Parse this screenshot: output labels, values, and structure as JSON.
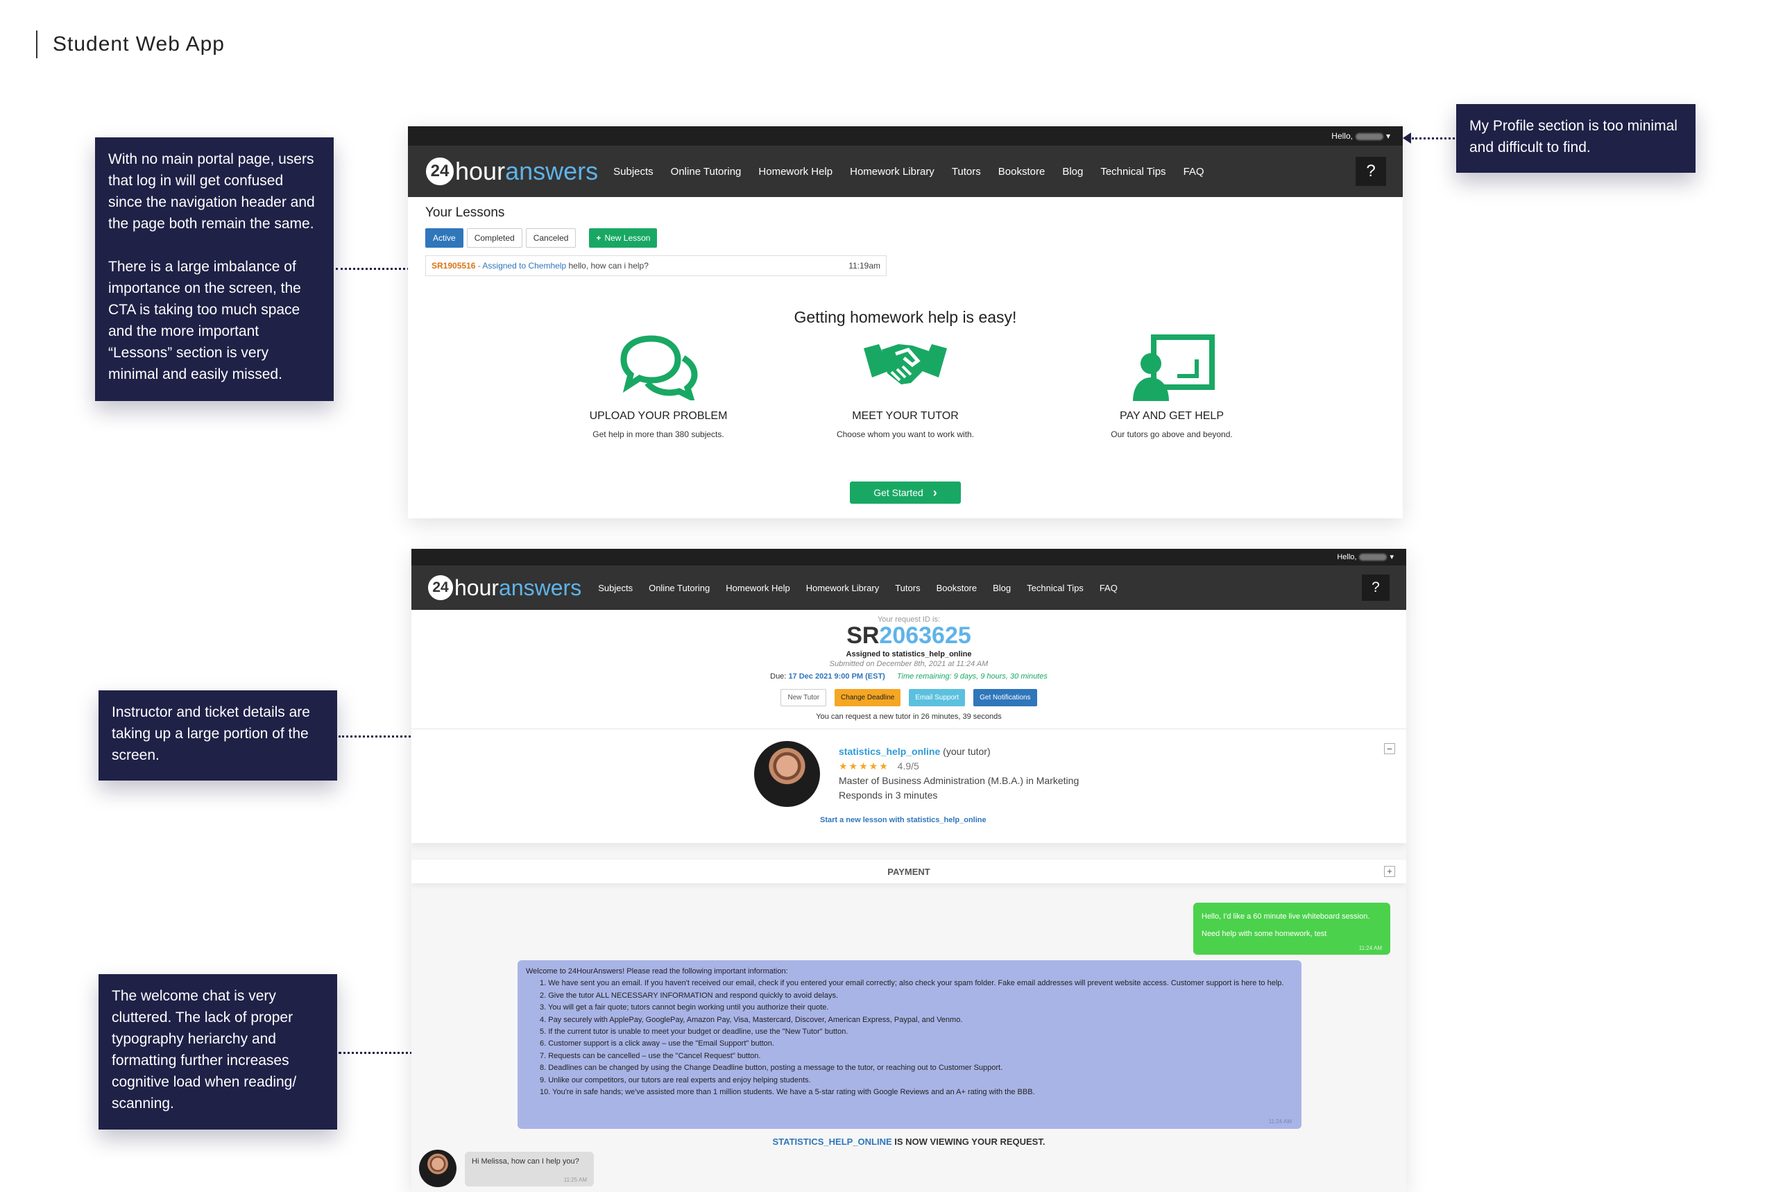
{
  "page": {
    "title": "Student Web App"
  },
  "notes": {
    "left1": "With no main portal page, users that log in will get confused since the navigation header and the page both remain the same.\n\nThere is a large imbalance of importance on the screen, the CTA is taking too much space and the more important “Lessons” section is very minimal and easily missed.",
    "right1": "My Profile section is too minimal and difficult to find.",
    "left2": "Instructor and ticket details are taking up a large portion of the screen.",
    "left3": "The welcome chat is very cluttered. The lack of proper typography heriarchy and formatting further increases cognitive load when reading/ scanning."
  },
  "app": {
    "hello": "Hello,",
    "logo_num": "24",
    "logo_hour": "hour",
    "logo_answers": "answers",
    "nav": [
      "Subjects",
      "Online Tutoring",
      "Homework Help",
      "Homework Library",
      "Tutors",
      "Bookstore",
      "Blog",
      "Technical Tips",
      "FAQ"
    ],
    "help": "?"
  },
  "lessons": {
    "title": "Your Lessons",
    "tabs": [
      "Active",
      "Completed",
      "Canceled"
    ],
    "new_lesson": "New Lesson",
    "item": {
      "id": "SR1905516",
      "sep": " - ",
      "assigned": "Assigned to Chemhelp",
      "msg": " hello, how can i help?",
      "time": "11:19am"
    }
  },
  "steps": {
    "heading": "Getting homework help is easy!",
    "items": [
      {
        "title": "UPLOAD YOUR PROBLEM",
        "sub": "Get help in more than 380 subjects."
      },
      {
        "title": "MEET YOUR TUTOR",
        "sub": "Choose whom you want to work with."
      },
      {
        "title": "PAY AND GET HELP",
        "sub": "Our tutors go above and beyond."
      }
    ],
    "cta": "Get Started"
  },
  "request": {
    "label": "Your request ID is:",
    "sr_prefix": "SR",
    "sr_num": "2063625",
    "assigned": "Assigned to statistics_help_online",
    "submitted": "Submitted on December 8th, 2021 at 11:24 AM",
    "due_label": "Due:",
    "due_value": "17 Dec 2021 9:00 PM (EST)",
    "time_remaining": "Time remaining: 9 days, 9 hours, 30 minutes",
    "buttons": [
      "New Tutor",
      "Change Deadline",
      "Email Support",
      "Get Notifications"
    ],
    "new_tutor_note": "You can request a new tutor in 26 minutes, 39 seconds"
  },
  "tutor": {
    "name": "statistics_help_online",
    "role": " (your tutor)",
    "stars": "★★★★★",
    "rating": "4.9/5",
    "degree": "Master of Business Administration (M.B.A.) in Marketing",
    "responds": "Responds in 3 minutes",
    "start_link": "Start a new lesson with statistics_help_online",
    "collapse": "−"
  },
  "payment": {
    "label": "PAYMENT",
    "expand": "+"
  },
  "chat": {
    "user_msg1": "Hello, I'd like a 60 minute live whiteboard session.",
    "user_msg2": "Need help with some homework, test",
    "user_time": "11:24 AM",
    "welcome_intro": "Welcome to 24HourAnswers! Please read the following important information:",
    "welcome_items": [
      "1. We have sent you an email. If you haven't received our email, check if you entered your email correctly; also check your spam folder. Fake email addresses will prevent website access. Customer support is here to help.",
      "2. Give the tutor ALL NECESSARY INFORMATION and respond quickly to avoid delays.",
      "3. You will get a fair quote; tutors cannot begin working until you authorize their quote.",
      "4. Pay securely with ApplePay, GooglePay, Amazon Pay, Visa, Mastercard, Discover, American Express, Paypal, and Venmo.",
      "5. If the current tutor is unable to meet your budget or deadline, use the \"New Tutor\" button.",
      "6. Customer support is a click away – use the \"Email Support\" button.",
      "7. Requests can be cancelled – use the \"Cancel Request\" button.",
      "8. Deadlines can be changed by using the Change Deadline button, posting a message to the tutor, or reaching out to Customer Support.",
      "9. Unlike our competitors, our tutors are real experts and enjoy helping students.",
      "10. You're in safe hands; we've assisted more than 1 million students. We have a 5-star rating with Google Reviews and an A+ rating with the BBB."
    ],
    "welcome_time": "11:24 AM",
    "viewing_name": "STATISTICS_HELP_ONLINE",
    "viewing_rest": " IS NOW VIEWING YOUR REQUEST.",
    "tutor_msg": "Hi Melissa, how can I help you?",
    "tutor_time": "11:25 AM"
  },
  "colors": {
    "accent_blue": "#2f76bb",
    "green": "#19a864",
    "navy": "#1f2147",
    "orange": "#f5a623",
    "cyan": "#5bc0de",
    "chat_purple": "#a9b4e6",
    "chat_green": "#4cd14c"
  }
}
